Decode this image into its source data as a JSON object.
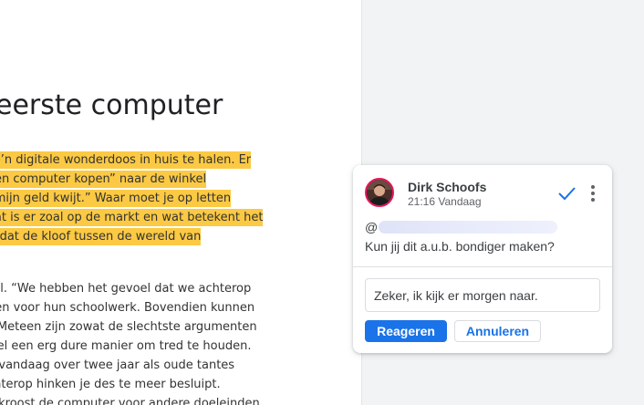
{
  "document": {
    "title": "eerste computer",
    "highlighted_lines": [
      "zo’n digitale wonderdoos in huis te halen. Er",
      "een computer kopen” naar de winkel",
      "l mijn geld kwijt.” Waar moet je op letten",
      "Vat is er zoal op de markt en wat betekent het",
      "ft dat de kloof tussen de wereld van"
    ],
    "body_lines": [
      "wil. “We hebben het gevoel dat we achterop",
      "pen voor hun schoolwerk. Bovendien kunnen",
      "” Meteen zijn zowat de slechtste argumenten",
      "wel een erg dure manier om tred te houden.",
      "n vandaag over twee jaar als oude tantes",
      "chterop hinken je des te meer besluipt.",
      "e kroost de computer voor andere doeleinden"
    ],
    "highlight_color": "#fbc943"
  },
  "comment": {
    "author": "Dirk Schoofs",
    "time": "21:16 Vandaag",
    "mention_prefix": "@",
    "text": "Kun jij dit a.u.b. bondiger maken?",
    "resolve_icon": "checkmark-icon",
    "more_icon": "more-vert-icon",
    "avatar_ring_color": "#e8175d",
    "reply": {
      "value": "Zeker, ik kijk er morgen naar.",
      "placeholder": ""
    },
    "reply_button_label": "Reageren",
    "cancel_button_label": "Annuleren",
    "accent_color": "#1a73e8"
  }
}
